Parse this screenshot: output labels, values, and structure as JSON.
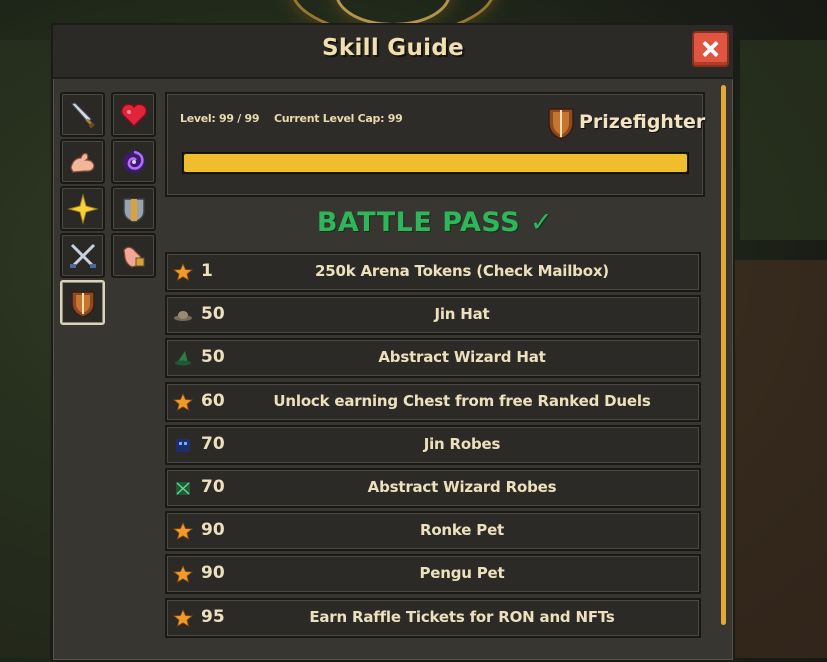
{
  "window": {
    "title": "Skill Guide"
  },
  "skills": [
    {
      "name": "sword-skill-icon"
    },
    {
      "name": "heart-skill-icon"
    },
    {
      "name": "strength-arm-skill-icon"
    },
    {
      "name": "vortex-skill-icon"
    },
    {
      "name": "star-skill-icon"
    },
    {
      "name": "shield-skill-icon"
    },
    {
      "name": "crossed-swords-skill-icon"
    },
    {
      "name": "hand-skill-icon"
    },
    {
      "name": "prizefighter-skill-icon"
    }
  ],
  "info": {
    "level_text": "Level: 99 / 99",
    "cap_text": "Current Level Cap: 99",
    "skill_name": "Prizefighter",
    "progress": 1.0,
    "progress_color": "#f0bd2c"
  },
  "battle_pass": {
    "title": "BATTLE PASS ✓",
    "color": "#2fb55a"
  },
  "rewards": [
    {
      "level": "1",
      "name": "250k Arena Tokens (Check Mailbox)",
      "icon": "star"
    },
    {
      "level": "50",
      "name": "Jin Hat",
      "icon": "hat"
    },
    {
      "level": "50",
      "name": "Abstract Wizard Hat",
      "icon": "wizard-hat"
    },
    {
      "level": "60",
      "name": "Unlock earning Chest from free Ranked Duels",
      "icon": "star"
    },
    {
      "level": "70",
      "name": "Jin Robes",
      "icon": "robe"
    },
    {
      "level": "70",
      "name": "Abstract Wizard Robes",
      "icon": "wizard-robe"
    },
    {
      "level": "90",
      "name": "Ronke Pet",
      "icon": "star"
    },
    {
      "level": "90",
      "name": "Pengu Pet",
      "icon": "star"
    },
    {
      "level": "95",
      "name": "Earn Raffle Tickets for RON and NFTs",
      "icon": "star"
    }
  ],
  "close_button": {
    "label": ""
  }
}
